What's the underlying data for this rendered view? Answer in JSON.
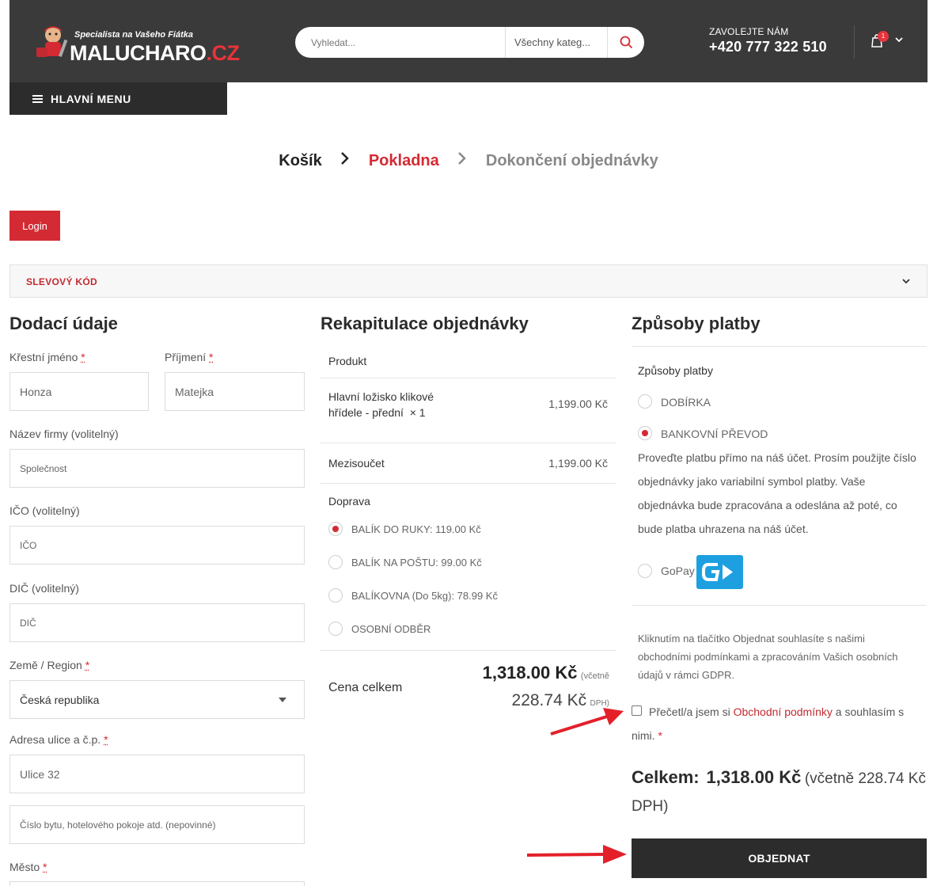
{
  "header": {
    "logo_tagline": "Specialista na Vašeho Fiátka",
    "logo_brand": "MALUCHARO",
    "logo_tld": ".CZ",
    "search_placeholder": "Vyhledat...",
    "search_category": "Všechny kateg...",
    "phone_label": "ZAVOLEJTE NÁM",
    "phone_number": "+420 777 322 510",
    "cart_count": "1",
    "menu_label": "HLAVNÍ MENU"
  },
  "steps": {
    "cart": "Košík",
    "checkout": "Pokladna",
    "complete": "Dokončení objednávky"
  },
  "login_label": "Login",
  "coupon_label": "SLEVOVÝ KÓD",
  "billing": {
    "title": "Dodací údaje",
    "first_name_label": "Křestní jméno",
    "first_name_value": "Honza",
    "last_name_label": "Příjmení",
    "last_name_value": "Matejka",
    "company_label": "Název firmy (volitelný)",
    "company_placeholder": "Společnost",
    "ico_label": "IČO (volitelný)",
    "ico_placeholder": "IČO",
    "dic_label": "DIČ (volitelný)",
    "dic_placeholder": "DIČ",
    "country_label": "Země / Region",
    "country_value": "Česká republika",
    "address_label": "Adresa ulice a č.p.",
    "address_value": "Ulice 32",
    "address2_placeholder": "Číslo bytu, hotelového pokoje atd. (nepovinné)",
    "city_label": "Město",
    "required_mark": "*"
  },
  "summary": {
    "title": "Rekapitulace objednávky",
    "product_header": "Produkt",
    "product_name_line1": "Hlavní ložisko klikové",
    "product_name_line2": "hřídele - přední",
    "product_qty": "× 1",
    "product_price": "1,199.00 Kč",
    "subtotal_label": "Mezisoučet",
    "subtotal_value": "1,199.00 Kč",
    "shipping_label": "Doprava",
    "shipping_options": [
      {
        "label": "BALÍK DO RUKY: 119.00 Kč",
        "selected": true
      },
      {
        "label": "BALÍK NA POŠTU: 99.00 Kč",
        "selected": false
      },
      {
        "label": "BALÍKOVNA (Do 5kg): 78.99 Kč",
        "selected": false
      },
      {
        "label": "OSOBNÍ ODBĚR",
        "selected": false
      }
    ],
    "total_label": "Cena celkem",
    "total_value": "1,318.00 Kč",
    "vat_prefix": "(včetně",
    "vat_value": "228.74 Kč",
    "vat_suffix": "DPH)"
  },
  "payment": {
    "title": "Způsoby platby",
    "subtitle": "Způsoby platby",
    "options": [
      {
        "label": "DOBÍRKA",
        "selected": false
      },
      {
        "label": "BANKOVNÍ PŘEVOD",
        "selected": true
      },
      {
        "label": "GoPay",
        "selected": false
      }
    ],
    "bank_desc": "Proveďte platbu přímo na náš účet. Prosím použijte číslo objednávky jako variabilní symbol platby. Vaše objednávka bude zpracována a odeslána až poté, co bude platba uhrazena na náš účet.",
    "gdpr_text": "Kliknutím na tlačítko Objednat souhlasíte s našimi obchodními podmínkami a zpracováním Vašich osobních údajů v rámci GDPR.",
    "terms_prefix": "Přečetl/a jsem si",
    "terms_link": "Obchodní podmínky",
    "terms_suffix": "a souhlasím s nimi.",
    "grand_total_label": "Celkem:",
    "grand_total_value": "1,318.00 Kč",
    "grand_total_vat": "(včetně 228.74 Kč DPH)",
    "order_button": "OBJEDNAT"
  },
  "colors": {
    "accent": "#d42a33",
    "header_bg": "#3a3a3a",
    "gopay_blue": "#1ea0e0"
  }
}
